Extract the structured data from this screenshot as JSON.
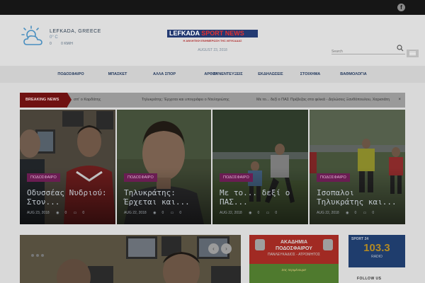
{
  "topbar": {
    "social_icon": "facebook-icon",
    "social_glyph": "f"
  },
  "weather": {
    "location": "LEFKADA, GREECE",
    "temperature": "0° C",
    "humidity": "0",
    "wind": "0 KM/H",
    "icon": "cloudy-sun-icon"
  },
  "logo": {
    "main": "LEFKADA",
    "accent": "SPORT NEWS",
    "tagline": "Η ΑΘΛΗΤΙΚΗ ΕΝΗΜΕΡΩΣΗ ΤΗΣ ΛΕΥΚΑΔΑΣ",
    "date": "AUGUST 23, 2018"
  },
  "search": {
    "placeholder": "Search"
  },
  "nav": {
    "items": [
      "ΠΟΔΟΣΦΑΙΡΟ",
      "ΜΠΑΣΚΕΤ",
      "ΑΛΛΑ ΣΠΟΡ",
      "ΑΡΘΡΑ",
      "ΣΥΝΕΝΤΕΥΞΕΙΣ",
      "ΕΚΔΗΛΩΣΕΙΣ",
      "ΣΤΟΙΧΗΜΑ",
      "ΒΑΘΜΟΛΟΓΙΑ"
    ]
  },
  "breaking": {
    "label": "BREAKING NEWS",
    "items": [
      "σπ' ο Καρδάτης",
      "Τηλυκράτης: Έρχεται και υπογράφει ο Ντεληγιώτης",
      "Με το... δεξί ο ΠΑΣ Πρέβεζας στα φιλικά - Δηλώσεις Ξανθόπουλου, Χαρισιάτη"
    ],
    "close": "×"
  },
  "slides": [
    {
      "category": "ΠΟΔΟΣΦΑΙΡΟ",
      "title": "Οδυσσέας Νυδριού: Στον...",
      "date": "AUG 23, 2018",
      "views": "0",
      "comments": "0"
    },
    {
      "category": "ΠΟΔΟΣΦΑΙΡΟ",
      "title": "Τηλυκράτης: Έρχεται και...",
      "date": "AUG 22, 2018",
      "views": "0",
      "comments": "0"
    },
    {
      "category": "ΠΟΔΟΣΦΑΙΡΟ",
      "title": "Με το... δεξί ο ΠΑΣ...",
      "date": "AUG 22, 2018",
      "views": "0",
      "comments": "0"
    },
    {
      "category": "ΠΟΔΟΣΦΑΙΡΟ",
      "title": "Ισοπαλοι Τηλυκράτης και...",
      "date": "AUG 22, 2018",
      "views": "0",
      "comments": "0"
    }
  ],
  "carousel": {
    "prev": "‹",
    "next": "›"
  },
  "ads": {
    "academy": {
      "line1": "ΑΚΑΔΗΜΙΑ",
      "line2": "ΠΟΔΟΣΦΑΙΡΟΥ",
      "line3": "ΠΑΝΛΕΥΚΑΔΙΟΣ - ΑΤΡΟΜΗΤΟΣ",
      "line4": "Σας περιμένουμε!"
    },
    "radio": {
      "brand": "SPORT 24",
      "frequency": "103.3",
      "label": "RADIO"
    }
  },
  "sidebar": {
    "label": "FOLLOW US"
  },
  "colors": {
    "accent": "#6f1111",
    "category": "#6a1d52",
    "nav_text": "#243a5e",
    "logo_bg": "#233a72"
  }
}
